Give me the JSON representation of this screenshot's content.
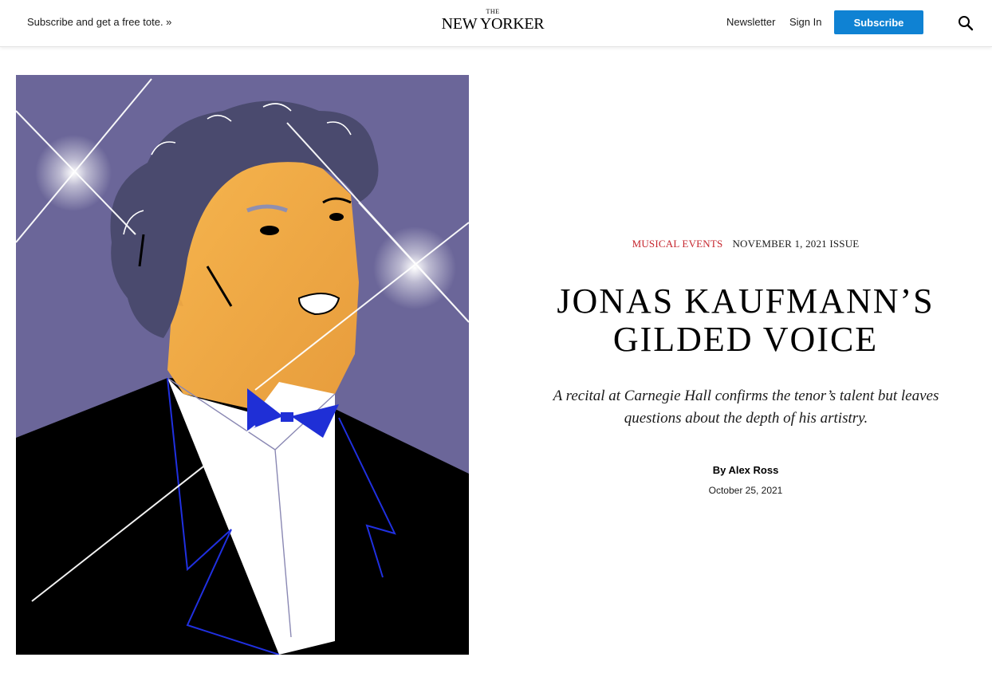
{
  "header": {
    "promo": "Subscribe and get a free tote. »",
    "logo_small": "THE",
    "logo_main": "NEW YORKER",
    "newsletter": "Newsletter",
    "sign_in": "Sign In",
    "subscribe": "Subscribe"
  },
  "article": {
    "rubric": "MUSICAL EVENTS",
    "issue": "NOVEMBER 1, 2021 ISSUE",
    "headline_line1": "JONAS KAUFMANN’S",
    "headline_line2": "GILDED VOICE",
    "dek": "A recital at Carnegie Hall confirms the tenor’s talent but leaves questions about the depth of his artistry.",
    "byline_prefix": "By ",
    "author": "Alex Ross",
    "date": "October 25, 2021"
  },
  "colors": {
    "accent_red": "#c6262e",
    "subscribe_blue": "#0f82d3",
    "illustration_background": "#6b6699",
    "bow_tie": "#1f2fd6"
  },
  "icons": {
    "search": "search-icon"
  }
}
